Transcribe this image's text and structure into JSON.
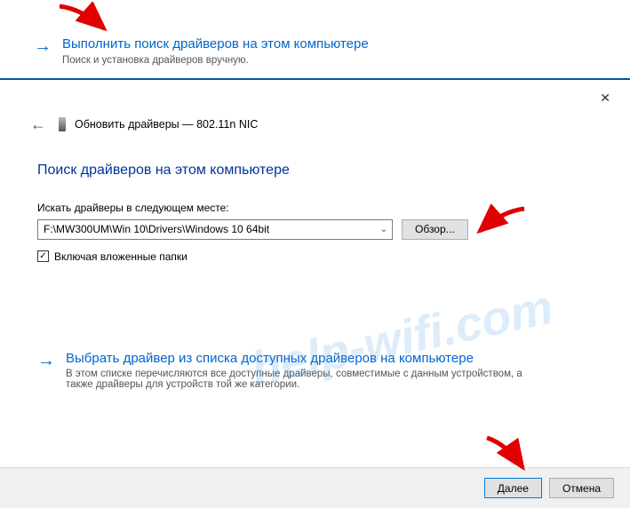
{
  "top_option": {
    "title": "Выполнить поиск драйверов на этом компьютере",
    "subtitle": "Поиск и установка драйверов вручную."
  },
  "dialog": {
    "header_prefix": "Обновить драйверы — ",
    "device": "802.11n NIC",
    "section_title": "Поиск драйверов на этом компьютере",
    "path_label": "Искать драйверы в следующем месте:",
    "path_value": "F:\\MW300UM\\Win 10\\Drivers\\Windows 10 64bit",
    "browse": "Обзор...",
    "include_sub": "Включая вложенные папки",
    "pick_title": "Выбрать драйвер из списка доступных драйверов на компьютере",
    "pick_sub": "В этом списке перечисляются все доступные драйверы, совместимые с данным устройством, а также драйверы для устройств той же категории.",
    "next": "Далее",
    "cancel": "Отмена"
  },
  "watermark": "help-wifi.com"
}
